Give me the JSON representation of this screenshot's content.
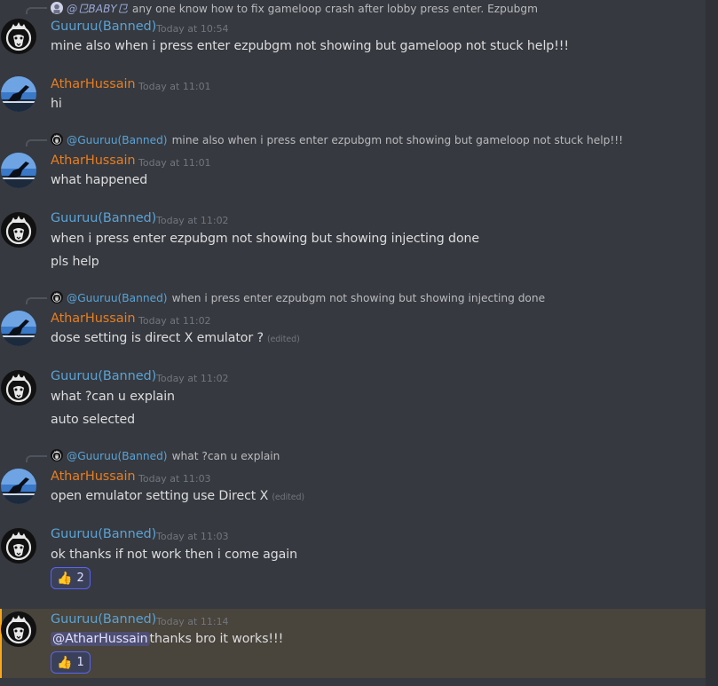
{
  "messages": {
    "m1": {
      "reply_user": "@⺋BABY⺋",
      "reply_text": "any one know how to fix gameloop crash after lobby press enter. Ezpubgm",
      "author": "Guuruu(Banned)",
      "timestamp": "Today at 10:54",
      "lines": [
        "mine also when i press enter ezpubgm not showing but gameloop not stuck help!!!"
      ]
    },
    "m2": {
      "author": "AtharHussain",
      "timestamp": "Today at 11:01",
      "lines": [
        "hi"
      ]
    },
    "m3": {
      "reply_user": "@Guuruu(Banned)",
      "reply_text": "mine also when i press enter ezpubgm not showing but gameloop not stuck help!!!",
      "author": "AtharHussain",
      "timestamp": "Today at 11:01",
      "lines": [
        "what happened"
      ]
    },
    "m4": {
      "author": "Guuruu(Banned)",
      "timestamp": "Today at 11:02",
      "lines": [
        "when i press enter ezpubgm not showing but showing injecting done",
        "pls help"
      ]
    },
    "m5": {
      "reply_user": "@Guuruu(Banned)",
      "reply_text": "when i press enter ezpubgm not showing but showing injecting done",
      "author": "AtharHussain",
      "timestamp": "Today at 11:02",
      "lines": [
        "dose setting is direct X emulator ?"
      ],
      "edited": "(edited)"
    },
    "m6": {
      "author": "Guuruu(Banned)",
      "timestamp": "Today at 11:02",
      "lines": [
        "what ?can u explain",
        "auto selected"
      ]
    },
    "m7": {
      "reply_user": "@Guuruu(Banned)",
      "reply_text": "what ?can u explain",
      "author": "AtharHussain",
      "timestamp": "Today at 11:03",
      "lines": [
        "open emulator setting use Direct X"
      ],
      "edited": "(edited)"
    },
    "m8": {
      "author": "Guuruu(Banned)",
      "timestamp": "Today at 11:03",
      "lines": [
        "ok thanks if not work then i come again"
      ],
      "reaction_emoji": "👍",
      "reaction_count": "2"
    },
    "m9": {
      "author": "Guuruu(Banned)",
      "timestamp": "Today at 11:14",
      "mention": "@AtharHussain",
      "text": "thanks bro it works!!!",
      "reaction_emoji": "👍",
      "reaction_count": "1"
    }
  },
  "colors": {
    "background": "#36393f",
    "guuruu_name": "#5aa3d6",
    "athar_name": "#e67e22",
    "highlight_bg": "#49443c",
    "reaction_border": "#5865f2"
  }
}
